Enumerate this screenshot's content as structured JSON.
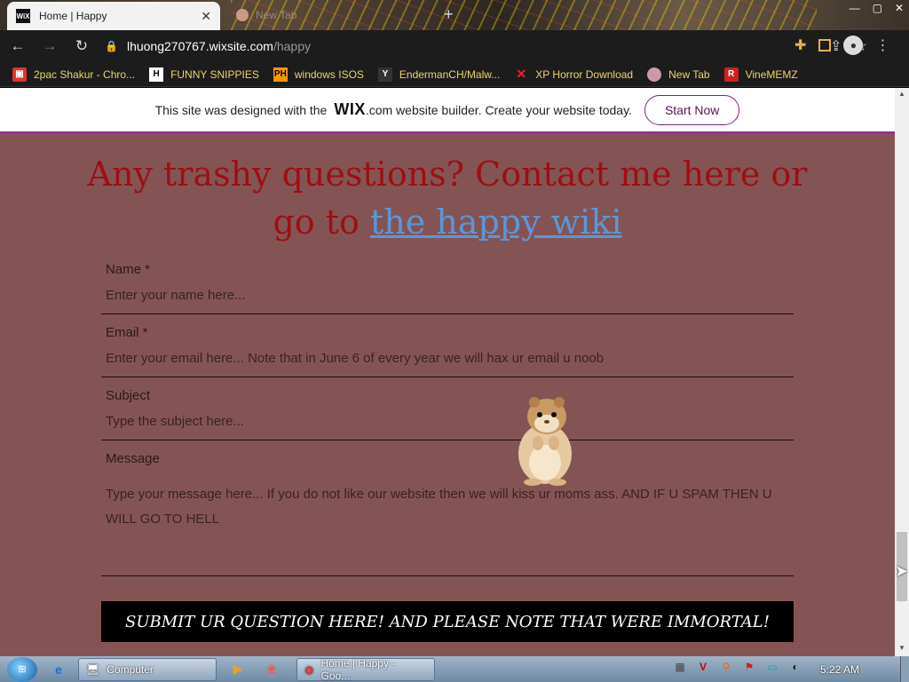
{
  "browser": {
    "tabs": [
      {
        "label": "Home | Happy",
        "favicon": "wix-icon",
        "active": true
      },
      {
        "label": "New Tab",
        "favicon": "newtab-icon",
        "active": false
      }
    ],
    "url_host": "lhuong270767.wixsite.com",
    "url_path": "/happy",
    "bookmarks": [
      {
        "label": "2pac Shakur - Chro...",
        "icon": "chrome-store-icon"
      },
      {
        "label": "FUNNY SNIPPIES",
        "icon": "H"
      },
      {
        "label": "windows ISOS",
        "icon": "PH"
      },
      {
        "label": "EndermanCH/Malw...",
        "icon": "YP"
      },
      {
        "label": "XP Horror Download",
        "icon": "X"
      },
      {
        "label": "New Tab",
        "icon": "newtab-icon"
      },
      {
        "label": "VineMEMZ",
        "icon": "R"
      }
    ]
  },
  "wix_banner": {
    "text_before": "This site was designed with the",
    "logo": "WIX",
    "text_after": ".com website builder. Create your website today.",
    "button": "Start Now"
  },
  "page": {
    "heading_line1": "Any trashy questions? Contact me here or",
    "heading_line2_prefix": "go to ",
    "heading_link": "the happy wiki",
    "form": {
      "name_label": "Name *",
      "name_placeholder": "Enter your name here...",
      "email_label": "Email *",
      "email_placeholder": "Enter your email here... Note that in June 6 of every year we will hax ur email u noob",
      "subject_label": "Subject",
      "subject_placeholder": "Type the subject here...",
      "message_label": "Message",
      "message_placeholder": "Type your message here... If you do not like our website then we will kiss ur moms ass. AND IF U SPAM THEN U WILL GO TO HELL",
      "submit": "SUBMIT UR QUESTION HERE! AND PLEASE NOTE THAT WERE IMMORTAL!"
    }
  },
  "taskbar": {
    "tasks": [
      {
        "label": "Computer",
        "icon": "computer-icon"
      },
      {
        "label": "Home | Happy - Goo...",
        "icon": "chrome-icon"
      }
    ],
    "clock": "5:22 AM"
  },
  "colors": {
    "page_bg": "#845454",
    "heading": "#9e0f12",
    "link": "#5a97d8",
    "submit_bg": "#000000"
  }
}
